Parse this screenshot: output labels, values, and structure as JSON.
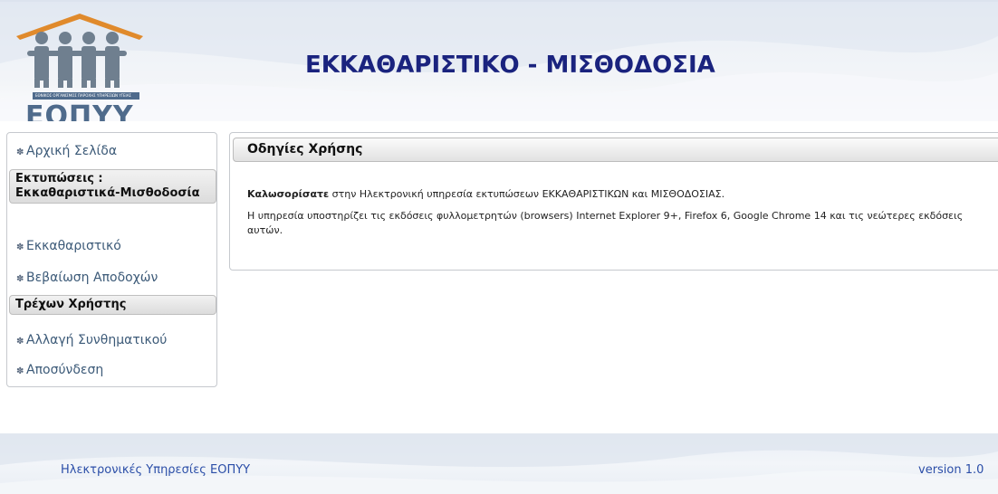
{
  "header": {
    "logo_text": "ΕΟΠΥΥ",
    "logo_strip_text": "ΕΘΝΙΚΟΣ ΟΡΓΑΝΙΣΜΟΣ ΠΑΡΟΧΗΣ ΥΠΗΡΕΣΙΩΝ ΥΓΕΙΑΣ",
    "title": "ΕΚΚΑΘΑΡΙΣΤΙΚΟ - ΜΙΣΘΟΔΟΣΙΑ",
    "title_color": "#1a237e",
    "logo_color": "#4f6b8c"
  },
  "sidebar": {
    "home": "Αρχική Σελίδα",
    "print_header": "Εκτυπώσεις : Εκκαθαριστικά-Μισθοδοσία",
    "clearance": "Εκκαθαριστικό",
    "earnings_cert": "Βεβαίωση Αποδοχών",
    "user_header": "Τρέχων Χρήστης",
    "change_password": "Αλλαγή Συνθηματικού",
    "logout": "Αποσύνδεση",
    "bullet_icon": "gear-bullet-icon"
  },
  "panel": {
    "title": "Οδηγίες Χρήσης",
    "welcome_bold": "Καλωσορίσατε",
    "welcome_rest": " στην Ηλεκτρονική υπηρεσία εκτυπώσεων ΕΚΚΑΘΑΡΙΣΤΙΚΩΝ και ΜΙΣΘΟΔΟΣΙΑΣ.",
    "browsers_text": "Η υπηρεσία υποστηρίζει τις εκδόσεις φυλλομετρητών (browsers) Internet Explorer 9+, Firefox 6, Google Chrome 14 και τις νεώτερες εκδόσεις αυτών."
  },
  "footer": {
    "left": "Ηλεκτρονικές Υπηρεσίες ΕΟΠΥΥ",
    "right": "version 1.0",
    "link_color": "#2b4ea8"
  }
}
